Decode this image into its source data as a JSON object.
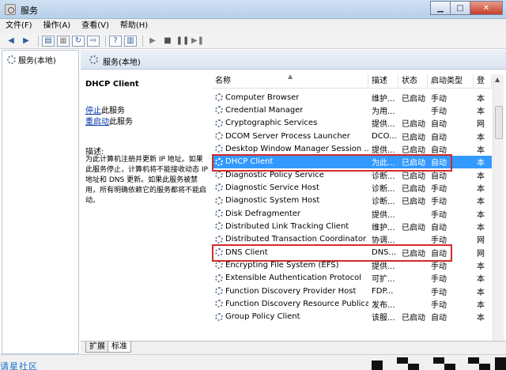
{
  "window": {
    "title": "服务"
  },
  "menu": [
    "文件(F)",
    "操作(A)",
    "查看(V)",
    "帮助(H)"
  ],
  "tree": {
    "root_label": "服务(本地)"
  },
  "pane": {
    "header": "服务(本地)"
  },
  "details": {
    "service_name": "DHCP Client",
    "stop_link": "停止",
    "stop_suffix": "此服务",
    "restart_link": "重启动",
    "restart_suffix": "此服务",
    "desc_label": "描述:",
    "desc_text": "为此计算机注册并更新 IP 地址。如果此服务停止，计算机将不能接收动态 IP 地址和 DNS 更新。如果此服务被禁用，所有明确依赖它的服务都将不能启动。"
  },
  "columns": {
    "name": "名称",
    "desc": "描述",
    "status": "状态",
    "startup": "启动类型",
    "logon": "登"
  },
  "services": [
    {
      "name": "Computer Browser",
      "desc": "维护...",
      "status": "已启动",
      "startup": "手动",
      "logon": "本"
    },
    {
      "name": "Credential Manager",
      "desc": "为用...",
      "status": "",
      "startup": "手动",
      "logon": "本"
    },
    {
      "name": "Cryptographic Services",
      "desc": "提供...",
      "status": "已启动",
      "startup": "自动",
      "logon": "网"
    },
    {
      "name": "DCOM Server Process Launcher",
      "desc": "DCO...",
      "status": "已启动",
      "startup": "自动",
      "logon": "本"
    },
    {
      "name": "Desktop Window Manager Session ...",
      "desc": "提供...",
      "status": "已启动",
      "startup": "自动",
      "logon": "本"
    },
    {
      "name": "DHCP Client",
      "desc": "为此...",
      "status": "已启动",
      "startup": "自动",
      "logon": "本",
      "selected": true
    },
    {
      "name": "Diagnostic Policy Service",
      "desc": "诊断...",
      "status": "已启动",
      "startup": "自动",
      "logon": "本"
    },
    {
      "name": "Diagnostic Service Host",
      "desc": "诊断...",
      "status": "已启动",
      "startup": "手动",
      "logon": "本"
    },
    {
      "name": "Diagnostic System Host",
      "desc": "诊断...",
      "status": "已启动",
      "startup": "手动",
      "logon": "本"
    },
    {
      "name": "Disk Defragmenter",
      "desc": "提供...",
      "status": "",
      "startup": "手动",
      "logon": "本"
    },
    {
      "name": "Distributed Link Tracking Client",
      "desc": "维护...",
      "status": "已启动",
      "startup": "自动",
      "logon": "本"
    },
    {
      "name": "Distributed Transaction Coordinator",
      "desc": "协调...",
      "status": "",
      "startup": "手动",
      "logon": "网"
    },
    {
      "name": "DNS Client",
      "desc": "DNS...",
      "status": "已启动",
      "startup": "自动",
      "logon": "网"
    },
    {
      "name": "Encrypting File System (EFS)",
      "desc": "提供...",
      "status": "",
      "startup": "手动",
      "logon": "本"
    },
    {
      "name": "Extensible Authentication Protocol",
      "desc": "可扩...",
      "status": "",
      "startup": "手动",
      "logon": "本"
    },
    {
      "name": "Function Discovery Provider Host",
      "desc": "FDP...",
      "status": "",
      "startup": "手动",
      "logon": "本"
    },
    {
      "name": "Function Discovery Resource Publicati...",
      "desc": "发布...",
      "status": "",
      "startup": "手动",
      "logon": "本"
    },
    {
      "name": "Group Policy Client",
      "desc": "该服...",
      "status": "已启动",
      "startup": "自动",
      "logon": "本"
    }
  ],
  "tabs": [
    "扩展",
    "标准"
  ],
  "watermark": "请星社区",
  "colors": {
    "selection": "#3399ff",
    "highlight_box": "#d22b2b",
    "link": "#0033aa"
  }
}
